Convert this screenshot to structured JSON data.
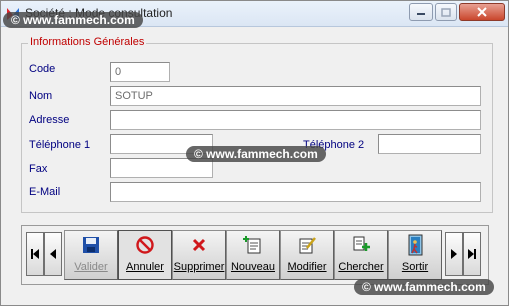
{
  "window": {
    "title": "Société : Mode consultation"
  },
  "watermark": {
    "text": "© www.fammech.com"
  },
  "group": {
    "title": "Informations Générales"
  },
  "fields": {
    "code": {
      "label": "Code",
      "value": "0"
    },
    "nom": {
      "label": "Nom",
      "value": "SOTUP"
    },
    "adresse": {
      "label": "Adresse",
      "value": ""
    },
    "telephone1": {
      "label": "Téléphone 1",
      "value": ""
    },
    "telephone2": {
      "label": "Téléphone 2",
      "value": ""
    },
    "fax": {
      "label": "Fax",
      "value": ""
    },
    "email": {
      "label": "E-Mail",
      "value": ""
    }
  },
  "toolbar": {
    "buttons": [
      {
        "label": "Valider",
        "icon": "floppy-disk-icon",
        "state": "disabled"
      },
      {
        "label": "Annuler",
        "icon": "cancel-circle-icon",
        "state": "pressed"
      },
      {
        "label": "Supprimer",
        "icon": "red-x-icon",
        "state": "normal"
      },
      {
        "label": "Nouveau",
        "icon": "new-document-icon",
        "state": "normal"
      },
      {
        "label": "Modifier",
        "icon": "edit-document-icon",
        "state": "normal"
      },
      {
        "label": "Chercher",
        "icon": "search-document-icon",
        "state": "normal"
      },
      {
        "label": "Sortir",
        "icon": "exit-door-icon",
        "state": "normal"
      }
    ]
  },
  "colors": {
    "group_title": "#c00000",
    "field_label": "#000080",
    "window_bg": "#f0f0f0"
  }
}
